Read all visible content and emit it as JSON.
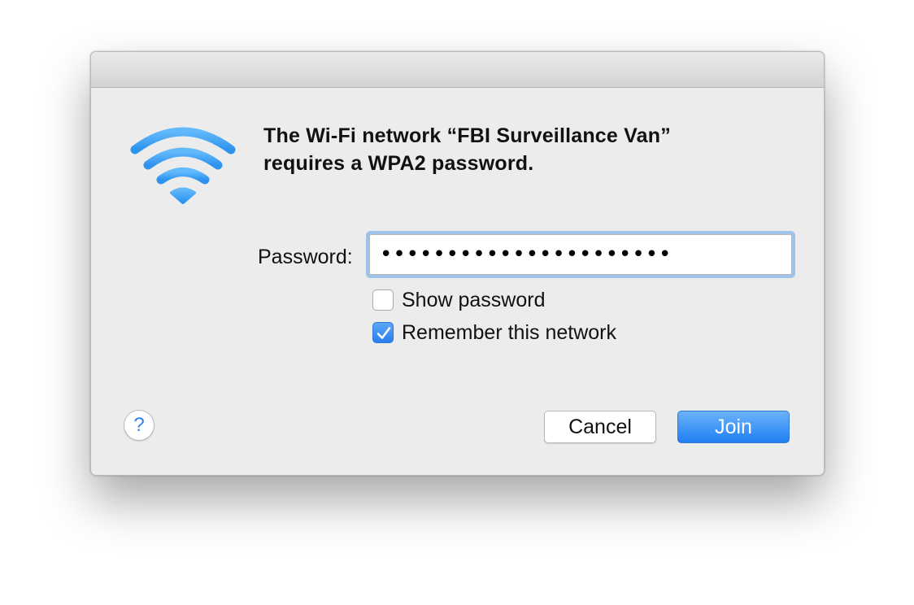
{
  "dialog": {
    "message_line1": "The Wi-Fi network “FBI Surveillance Van”",
    "message_line2": "requires a WPA2 password.",
    "icon": "wifi-icon",
    "accent_color": "#3aa0f6"
  },
  "password": {
    "label": "Password:",
    "value": "••••••••••••••••••••••"
  },
  "options": {
    "show_password": {
      "label": "Show password",
      "checked": false
    },
    "remember_network": {
      "label": "Remember this network",
      "checked": true
    }
  },
  "buttons": {
    "help": "?",
    "cancel": "Cancel",
    "join": "Join"
  }
}
